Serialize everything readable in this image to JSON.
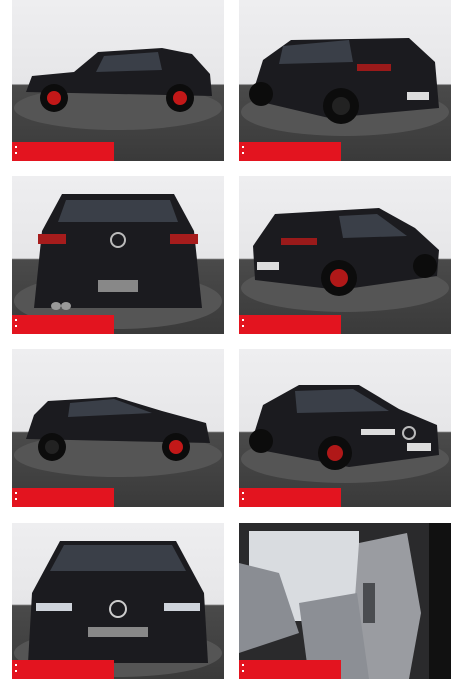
{
  "gallery": {
    "photos": [
      {
        "view": "side-left",
        "badge": ""
      },
      {
        "view": "rear-three-quarter-left",
        "badge": ""
      },
      {
        "view": "rear",
        "badge": ""
      },
      {
        "view": "rear-three-quarter-right",
        "badge": ""
      },
      {
        "view": "side-left-alt",
        "badge": ""
      },
      {
        "view": "front-three-quarter-right",
        "badge": ""
      },
      {
        "view": "front",
        "badge": ""
      },
      {
        "view": "interior-front-seats",
        "badge": ""
      }
    ]
  },
  "colors": {
    "badge": "#e3141f",
    "car_body": "#1a1a1e",
    "floor": "#3d3d3d",
    "backdrop": "#ebebed"
  }
}
